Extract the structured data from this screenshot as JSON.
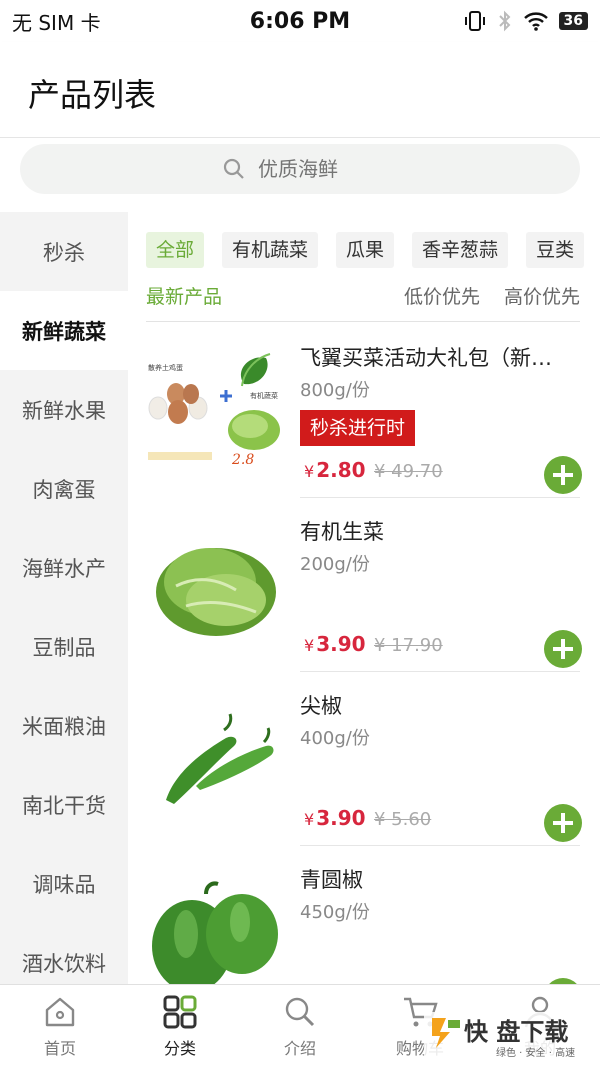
{
  "status_bar": {
    "carrier": "无 SIM 卡",
    "time": "6:06 PM",
    "battery": "36"
  },
  "header": {
    "title": "产品列表"
  },
  "search": {
    "placeholder": "优质海鲜"
  },
  "sidebar": {
    "items": [
      {
        "label": "秒杀"
      },
      {
        "label": "新鲜蔬菜",
        "active": true
      },
      {
        "label": "新鲜水果"
      },
      {
        "label": "肉禽蛋"
      },
      {
        "label": "海鲜水产"
      },
      {
        "label": "豆制品"
      },
      {
        "label": "米面粮油"
      },
      {
        "label": "南北干货"
      },
      {
        "label": "调味品"
      },
      {
        "label": "酒水饮料"
      }
    ]
  },
  "chips": [
    {
      "label": "全部",
      "active": true
    },
    {
      "label": "有机蔬菜"
    },
    {
      "label": "瓜果"
    },
    {
      "label": "香辛葱蒜"
    },
    {
      "label": "豆类"
    }
  ],
  "sort": {
    "newest": "最新产品",
    "low": "低价优先",
    "high": "高价优先"
  },
  "products": [
    {
      "name": "飞翼买菜活动大礼包（新…",
      "spec": "800g/份",
      "tag": "秒杀进行时",
      "price": "2.80",
      "old_price": "¥ 49.70",
      "currency": "¥"
    },
    {
      "name": "有机生菜",
      "spec": "200g/份",
      "price": "3.90",
      "old_price": "¥ 17.90",
      "currency": "¥"
    },
    {
      "name": "尖椒",
      "spec": "400g/份",
      "price": "3.90",
      "old_price": "¥ 5.60",
      "currency": "¥"
    },
    {
      "name": "青圆椒",
      "spec": "450g/份",
      "price": "",
      "old_price": "",
      "currency": ""
    }
  ],
  "bundle_image_text": {
    "eggs": "散养土鸡蛋",
    "veg": "有机蔬菜",
    "price": "2.8"
  },
  "tabbar": [
    {
      "label": "首页",
      "icon": "home-icon"
    },
    {
      "label": "分类",
      "icon": "grid-icon",
      "active": true
    },
    {
      "label": "介绍",
      "icon": "search-icon"
    },
    {
      "label": "购物车",
      "icon": "cart-icon"
    },
    {
      "label": "我的",
      "icon": "user-icon"
    }
  ],
  "watermark": {
    "text": "快 盘下载",
    "sub": "绿色 · 安全 · 高速"
  },
  "colors": {
    "accent": "#6aab37",
    "price": "#d7263d",
    "tag": "#d11b1b"
  }
}
